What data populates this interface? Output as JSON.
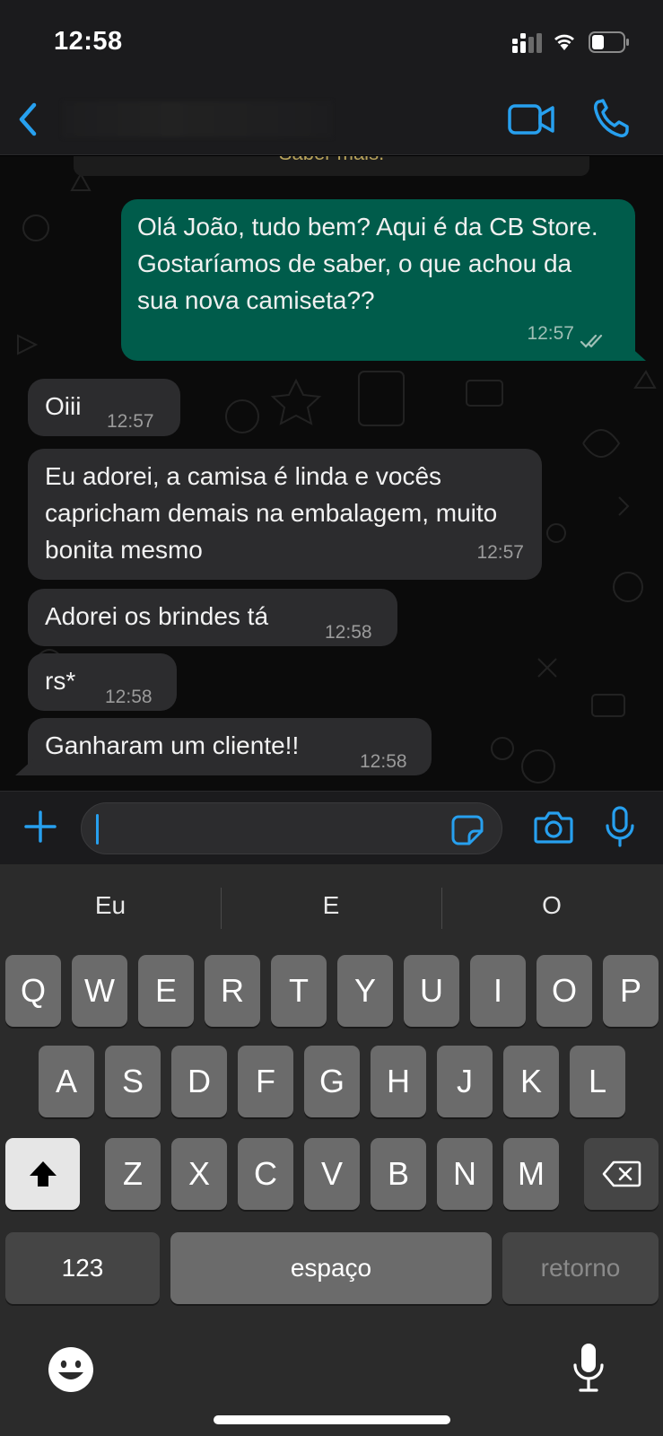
{
  "status_bar": {
    "time": "12:58"
  },
  "header": {
    "contact_name": ""
  },
  "chat": {
    "top_notice": "Saber mais.",
    "messages": [
      {
        "direction": "outgoing",
        "text": "Olá João, tudo bem? Aqui é da CB Store. Gostaríamos de saber, o que achou da sua nova camiseta??",
        "time": "12:57",
        "status": "read"
      },
      {
        "direction": "incoming",
        "text": "Oiii",
        "time": "12:57"
      },
      {
        "direction": "incoming",
        "text": "Eu adorei, a camisa é linda e vocês capricham demais na embalagem, muito bonita mesmo",
        "time": "12:57"
      },
      {
        "direction": "incoming",
        "text": "Adorei os brindes tá",
        "time": "12:58"
      },
      {
        "direction": "incoming",
        "text": "rs*",
        "time": "12:58"
      },
      {
        "direction": "incoming",
        "text": "Ganharam um cliente!!",
        "time": "12:58"
      }
    ]
  },
  "input": {
    "value": ""
  },
  "keyboard": {
    "suggestions": [
      "Eu",
      "E",
      "O"
    ],
    "row1": [
      "Q",
      "W",
      "E",
      "R",
      "T",
      "Y",
      "U",
      "I",
      "O",
      "P"
    ],
    "row2": [
      "A",
      "S",
      "D",
      "F",
      "G",
      "H",
      "J",
      "K",
      "L"
    ],
    "row3": [
      "Z",
      "X",
      "C",
      "V",
      "B",
      "N",
      "M"
    ],
    "numbers_label": "123",
    "space_label": "espaço",
    "return_label": "retorno"
  },
  "colors": {
    "accent": "#27a0ef",
    "outgoing_bubble": "#005c4b",
    "incoming_bubble": "#2c2c2e",
    "chat_background": "#0b0b0b"
  },
  "icons": {
    "back": "chevron-left-icon",
    "video": "video-camera-icon",
    "call": "phone-icon",
    "plus": "plus-icon",
    "sticker": "sticker-icon",
    "camera": "camera-icon",
    "mic": "microphone-icon",
    "shift": "shift-icon",
    "delete": "backspace-icon",
    "emoji": "emoji-icon",
    "dictation": "dictation-mic-icon"
  }
}
